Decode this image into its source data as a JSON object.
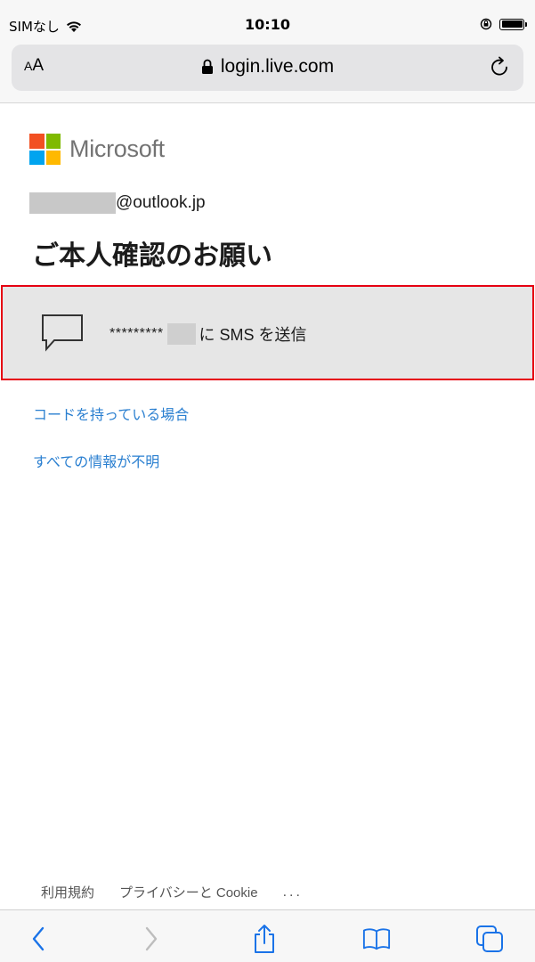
{
  "status_bar": {
    "carrier": "SIMなし",
    "time": "10:10",
    "icons": [
      "wifi-icon",
      "orientation-lock-icon",
      "battery-icon"
    ]
  },
  "address_bar": {
    "text_size_label_small": "A",
    "text_size_label_large": "A",
    "url": "login.live.com",
    "icons": [
      "lock-icon",
      "reload-icon"
    ]
  },
  "brand": {
    "name": "Microsoft",
    "colors": [
      "#f25022",
      "#7fba00",
      "#00a4ef",
      "#ffb900"
    ]
  },
  "account": {
    "email_suffix": "@outlook.jp"
  },
  "page": {
    "title": "ご本人確認のお願い"
  },
  "verification_option": {
    "masked_number": "*********",
    "label": "に SMS を送信",
    "icon": "chat-bubble-icon",
    "highlight_color": "#e60012"
  },
  "links": {
    "have_code": "コードを持っている場合",
    "dont_know": "すべての情報が不明"
  },
  "footer": {
    "terms": "利用規約",
    "privacy": "プライバシーと Cookie",
    "more": "..."
  },
  "toolbar": {
    "icons": [
      "back-icon",
      "forward-icon",
      "share-icon",
      "bookmarks-icon",
      "tabs-icon"
    ]
  },
  "colors": {
    "link": "#2a7fd0",
    "text": "#1b1b1b",
    "option_bg": "#e6e6e6"
  }
}
